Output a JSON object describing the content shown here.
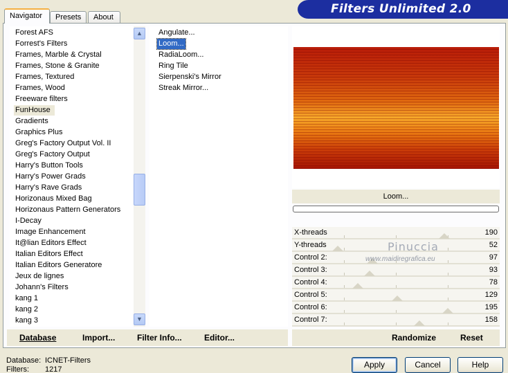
{
  "tabs": [
    "Navigator",
    "Presets",
    "About"
  ],
  "banner_title": "Filters Unlimited 2.0",
  "categories": [
    "Forest AFS",
    "Forrest's Filters",
    "Frames, Marble & Crystal",
    "Frames, Stone & Granite",
    "Frames, Textured",
    "Frames, Wood",
    "Freeware filters",
    "FunHouse",
    "Gradients",
    "Graphics Plus",
    "Greg's Factory Output Vol. II",
    "Greg's Factory Output",
    "Harry's Button Tools",
    "Harry's Power Grads",
    "Harry's Rave Grads",
    "Horizonaus Mixed Bag",
    "Horizonaus Pattern Generators",
    "I-Decay",
    "Image Enhancement",
    "It@lian Editors Effect",
    "Italian Editors Effect",
    "Italian Editors Generatore",
    "Jeux de lignes",
    "Johann's Filters",
    "kang 1",
    "kang 2",
    "kang 3"
  ],
  "selected_category": "FunHouse",
  "filters": [
    "Angulate...",
    "Loom...",
    "RadiaLoom...",
    "Ring Tile",
    "Sierpenski's Mirror",
    "Streak Mirror..."
  ],
  "selected_filter": "Loom...",
  "preview_filter_name": "Loom...",
  "controls": [
    {
      "label": "X-threads",
      "value": "190",
      "level": 190
    },
    {
      "label": "Y-threads",
      "value": "52",
      "level": 52
    },
    {
      "label": "Control 2:",
      "value": "97",
      "level": 97
    },
    {
      "label": "Control 3:",
      "value": "93",
      "level": 93
    },
    {
      "label": "Control 4:",
      "value": "78",
      "level": 78
    },
    {
      "label": "Control 5:",
      "value": "129",
      "level": 129
    },
    {
      "label": "Control 6:",
      "value": "195",
      "level": 195
    },
    {
      "label": "Control 7:",
      "value": "158",
      "level": 158
    }
  ],
  "control_max": 255,
  "watermark": {
    "name": "Pinuccia",
    "site": "www.maidiregrafica.eu"
  },
  "toolbar": {
    "database": "Database",
    "import": "Import...",
    "filter_info": "Filter Info...",
    "editor": "Editor..."
  },
  "preview_actions": {
    "randomize": "Randomize",
    "reset": "Reset"
  },
  "status": {
    "database_label": "Database:",
    "database_value": "ICNET-Filters",
    "filters_label": "Filters:",
    "filters_value": "1217"
  },
  "buttons": {
    "apply": "Apply",
    "cancel": "Cancel",
    "help": "Help"
  },
  "colors": {
    "banner": "#1c2ea0",
    "selection": "#316ac5"
  }
}
